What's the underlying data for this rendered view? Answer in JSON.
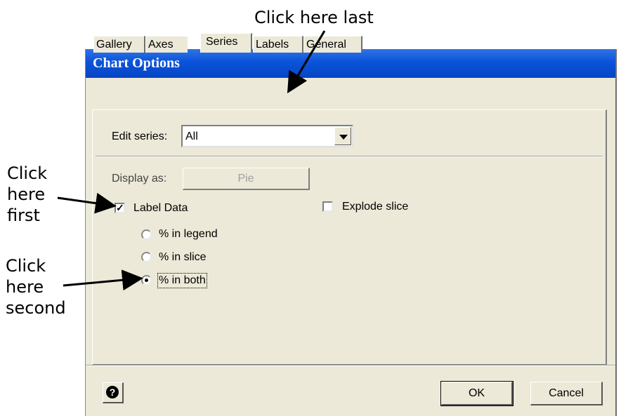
{
  "annotations": {
    "top": "Click here last",
    "first_lines": [
      "Click",
      "here",
      "first"
    ],
    "second_lines": [
      "Click",
      "here",
      "second"
    ]
  },
  "dialog": {
    "title": "Chart Options",
    "tabs": [
      {
        "label": "Gallery",
        "active": false
      },
      {
        "label": "Axes",
        "active": false
      },
      {
        "label": "Series",
        "active": true
      },
      {
        "label": "Labels",
        "active": false
      },
      {
        "label": "General",
        "active": false
      }
    ],
    "edit_series": {
      "label": "Edit series:",
      "value": "All"
    },
    "display_as": {
      "label": "Display as:",
      "value": "Pie",
      "enabled": false
    },
    "label_data": {
      "label": "Label Data",
      "checked": true
    },
    "explode_slice": {
      "label": "Explode slice",
      "checked": false
    },
    "radio_options": [
      {
        "label": "% in legend",
        "selected": false
      },
      {
        "label": "% in slice",
        "selected": false
      },
      {
        "label": "% in both",
        "selected": true
      }
    ],
    "buttons": {
      "ok": "OK",
      "cancel": "Cancel",
      "help": "?"
    }
  },
  "colors": {
    "titlebar": "#0a53d9",
    "dialog_bg": "#ece9d8",
    "title_text": "#ffffff"
  }
}
